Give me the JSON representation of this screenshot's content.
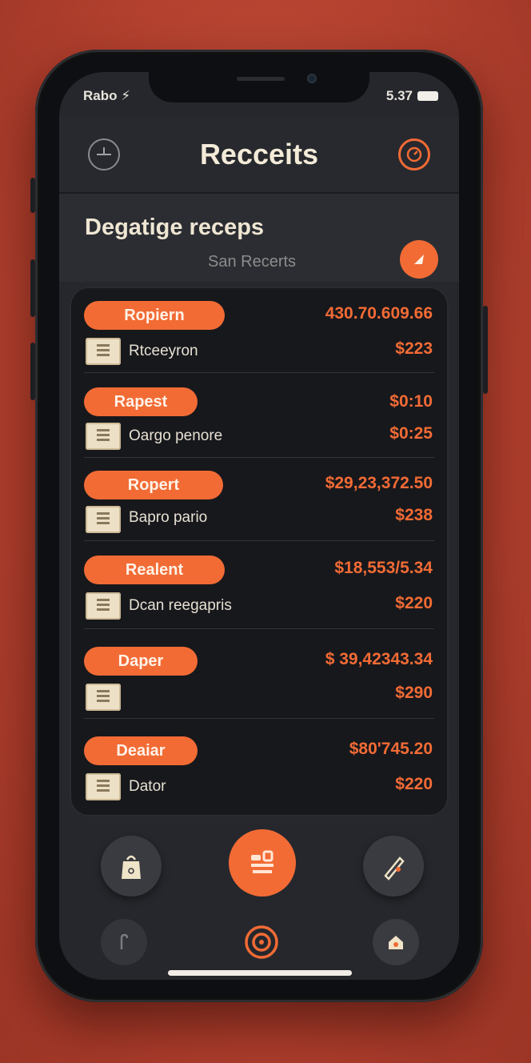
{
  "status_bar": {
    "carrier": "Rabo ⚡",
    "time": "5.37"
  },
  "header": {
    "title": "Recceits"
  },
  "subheader": {
    "title": "Degatige receps",
    "label": "San Recerts"
  },
  "receipts": [
    {
      "tag": "Ropiern",
      "total": "430.70.609.66",
      "description": "Rtceeyron",
      "amount": "$223"
    },
    {
      "tag": "Rapest",
      "total": "$0:10",
      "description": "Oargo penore",
      "amount": "$0:25"
    },
    {
      "tag": "Ropert",
      "total": "$29,23,372.50",
      "description": "Bapro pario",
      "amount": "$238"
    },
    {
      "tag": "Realent",
      "total": "$18,553/5.34",
      "description": "Dcan reegapris",
      "amount": "$220"
    },
    {
      "tag": "Daper",
      "total": "$ 39,42343.34",
      "description": "",
      "amount": "$290"
    },
    {
      "tag": "Deaiar",
      "total": "$80'745.20",
      "description": "Dator",
      "amount": "$220"
    }
  ],
  "icons": {
    "header_left": "clock-icon",
    "header_right": "target-icon",
    "subheader_action": "arrow-icon",
    "nav": [
      "shopping-bag-icon",
      "receipt-scan-icon",
      "pen-icon",
      "hook-icon",
      "target-icon",
      "home-icon"
    ]
  },
  "colors": {
    "accent": "#f26b35",
    "background": "#b4412f",
    "screen": "#25272c",
    "card": "#17181c"
  }
}
